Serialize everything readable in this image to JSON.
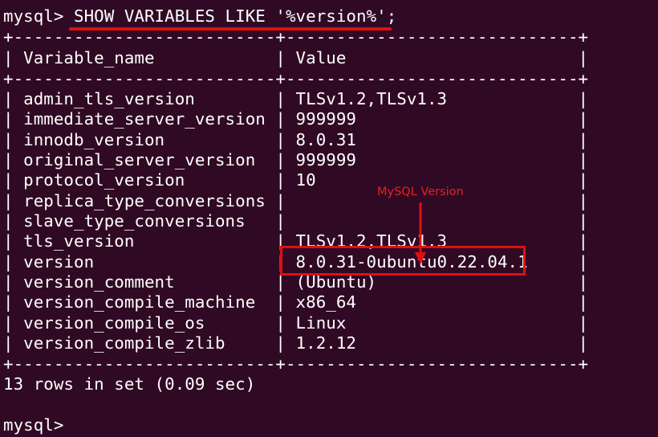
{
  "terminal": {
    "prompt_line": "mysql> SHOW VARIABLES LIKE '%version%';",
    "border_top": "+--------------------------+-----------------------------+",
    "header": "| Variable_name            | Value                       |",
    "border_mid": "+--------------------------+-----------------------------+",
    "rows": [
      "| admin_tls_version        | TLSv1.2,TLSv1.3             |",
      "| immediate_server_version | 999999                      |",
      "| innodb_version           | 8.0.31                      |",
      "| original_server_version  | 999999                      |",
      "| protocol_version         | 10                          |",
      "| replica_type_conversions |                             |",
      "| slave_type_conversions   |                             |",
      "| tls_version              | TLSv1.2,TLSv1.3             |",
      "| version                  | 8.0.31-0ubuntu0.22.04.1     |",
      "| version_comment          | (Ubuntu)                    |",
      "| version_compile_machine  | x86_64                      |",
      "| version_compile_os       | Linux                       |",
      "| version_compile_zlib     | 1.2.12                      |"
    ],
    "border_bottom": "+--------------------------+-----------------------------+",
    "result_summary": "13 rows in set (0.09 sec)",
    "final_prompt": "mysql> "
  },
  "annotation": {
    "label": "MySQL Version",
    "color": "#e01010"
  },
  "colors": {
    "background": "#300a24",
    "text": "#ffffff",
    "accent": "#e01010"
  }
}
